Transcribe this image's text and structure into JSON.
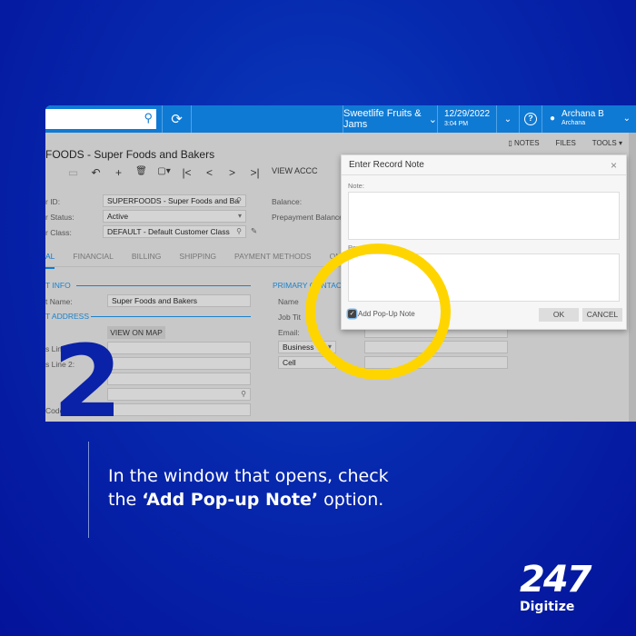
{
  "topbar": {
    "search_placeholder": "",
    "company": "Sweetlife Fruits & Jams",
    "date": "12/29/2022",
    "time": "3:04 PM",
    "user_name": "Archana B",
    "user_sub": "Archana",
    "help_glyph": "?"
  },
  "page": {
    "title": "FOODS - Super Foods and Bakers",
    "toolbar": {
      "save": "▭",
      "undo": "↶",
      "add": "+",
      "delete": "🗑",
      "copy": "▢▾",
      "first": "|<",
      "prev": "<",
      "next": ">",
      "last": ">|",
      "view_account": "VIEW ACCC"
    },
    "right_tools": {
      "notes": "▯ NOTES",
      "files": "FILES",
      "tools": "TOOLS ▾"
    }
  },
  "form": {
    "customer_id_label": "r ID:",
    "customer_id_value": "SUPERFOODS - Super Foods and Ba",
    "status_label": "r Status:",
    "status_value": "Active",
    "class_label": "r Class:",
    "class_value": "DEFAULT - Default Customer Class",
    "balance_label": "Balance:",
    "prepayment_label": "Prepayment Balance",
    "tabs": [
      "AL",
      "FINANCIAL",
      "BILLING",
      "SHIPPING",
      "PAYMENT METHODS",
      "ONT"
    ],
    "account_info": "T INFO",
    "account_name_label": "t Name:",
    "account_name_value": "Super Foods and Bakers",
    "account_address": "T ADDRESS",
    "view_on_map": "VIEW ON MAP",
    "line1_label": "s Line 1:",
    "line2_label": "s Line 2:",
    "code_label": "Code:",
    "primary_contact": "PRIMARY CONTACT",
    "name_label": "Name",
    "job_title_label": "Job Tit",
    "email_label": "Email:",
    "phone1_type": "Business",
    "phone2_type": "Cell"
  },
  "dialog": {
    "title": "Enter Record Note",
    "note_label": "Note:",
    "note_value": "",
    "popup_label": "Pop-Up Note:",
    "popup_value": "",
    "checkbox_label": "Add Pop-Up Note",
    "checkbox_checked": true,
    "ok": "OK",
    "cancel": "CANCEL",
    "close_glyph": "×"
  },
  "overlay": {
    "step_number": "2",
    "caption_pre": "In the window that opens, check",
    "caption_the": "the ",
    "caption_bold": "‘Add Pop-up Note’",
    "caption_post": " option.",
    "logo_number": "247",
    "logo_word": "Digitize",
    "highlight_color": "#ffd500",
    "brand_blue": "#0628ad"
  }
}
